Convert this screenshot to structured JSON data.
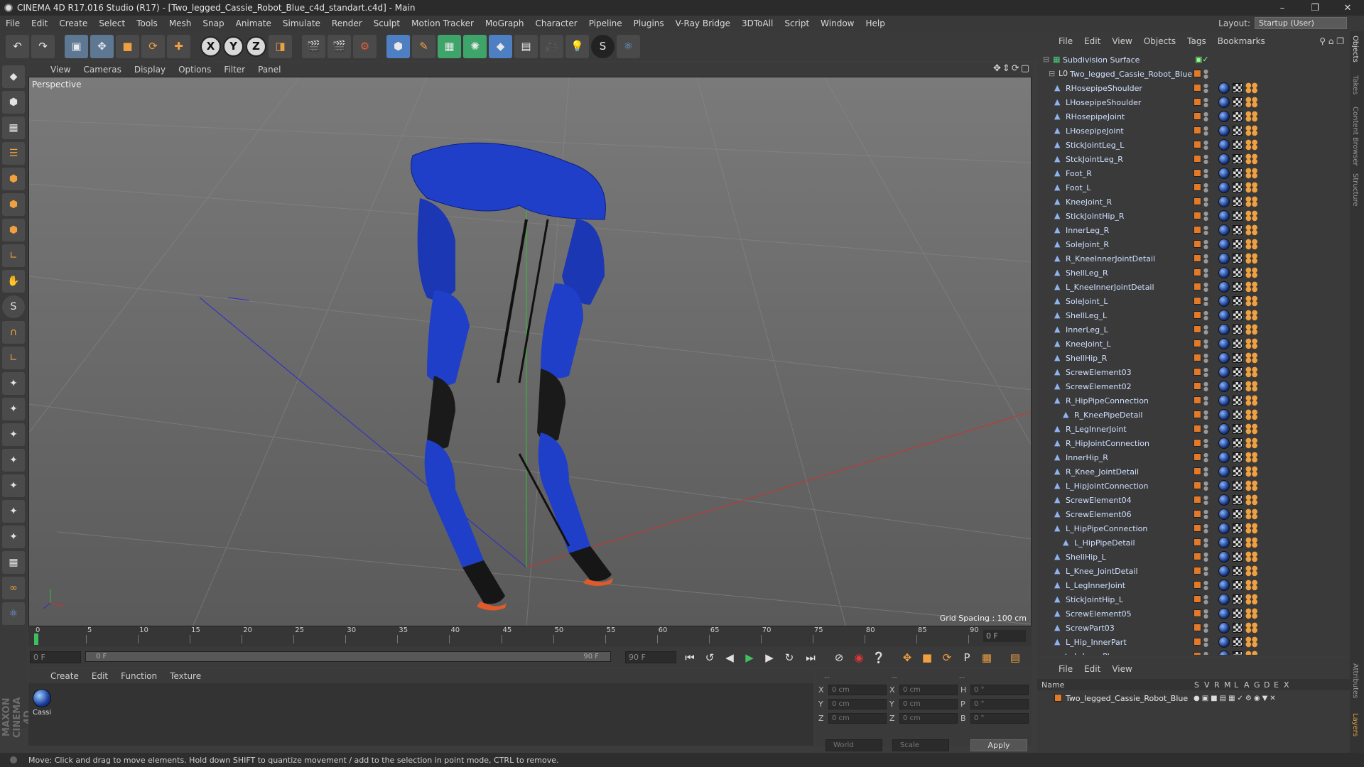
{
  "titlebar": {
    "title": "CINEMA 4D R17.016 Studio (R17) - [Two_legged_Cassie_Robot_Blue_c4d_standart.c4d] - Main"
  },
  "menubar": [
    "File",
    "Edit",
    "Create",
    "Select",
    "Tools",
    "Mesh",
    "Snap",
    "Animate",
    "Simulate",
    "Render",
    "Sculpt",
    "Motion Tracker",
    "MoGraph",
    "Character",
    "Pipeline",
    "Plugins",
    "V-Ray Bridge",
    "3DToAll",
    "Script",
    "Window",
    "Help"
  ],
  "layout": {
    "label": "Layout:",
    "value": "Startup (User)"
  },
  "viewport": {
    "menu": [
      "View",
      "Cameras",
      "Display",
      "Options",
      "Filter",
      "Panel"
    ],
    "label": "Perspective",
    "grid_spacing": "Grid Spacing : 100 cm"
  },
  "timeline": {
    "ticks": [
      "0",
      "5",
      "10",
      "15",
      "20",
      "25",
      "30",
      "35",
      "40",
      "45",
      "50",
      "55",
      "60",
      "65",
      "70",
      "75",
      "80",
      "85",
      "90"
    ],
    "current_frame": "0 F"
  },
  "transport": {
    "start": "0 F",
    "slider_start": "0 F",
    "slider_end": "90 F",
    "end": "90 F"
  },
  "material_manager": {
    "menu": [
      "Create",
      "Edit",
      "Function",
      "Texture"
    ],
    "materials": [
      {
        "name": "Cassi"
      }
    ]
  },
  "attributes": {
    "headers": [
      "--",
      "--",
      "--"
    ],
    "rows": [
      {
        "a": "X",
        "av": "0 cm",
        "b": "X",
        "bv": "0 cm",
        "c": "H",
        "cv": "0 °"
      },
      {
        "a": "Y",
        "av": "0 cm",
        "b": "Y",
        "bv": "0 cm",
        "c": "P",
        "cv": "0 °"
      },
      {
        "a": "Z",
        "av": "0 cm",
        "b": "Z",
        "bv": "0 cm",
        "c": "B",
        "cv": "0 °"
      }
    ],
    "coord_mode": "World",
    "scale_mode": "Scale",
    "apply_label": "Apply"
  },
  "status": {
    "text": "Move: Click and drag to move elements. Hold down SHIFT to quantize movement / add to the selection in point mode, CTRL to remove."
  },
  "object_manager": {
    "menu": [
      "File",
      "Edit",
      "View",
      "Objects",
      "Tags",
      "Bookmarks"
    ],
    "root": "Subdivision Surface",
    "group": "Two_legged_Cassie_Robot_Blue",
    "objects": [
      {
        "name": "RHosepipeShoulder",
        "indent": 0
      },
      {
        "name": "LHosepipeShoulder",
        "indent": 0
      },
      {
        "name": "RHosepipeJoint",
        "indent": 0
      },
      {
        "name": "LHosepipeJoint",
        "indent": 0
      },
      {
        "name": "StickJointLeg_L",
        "indent": 0
      },
      {
        "name": "StckJointLeg_R",
        "indent": 0
      },
      {
        "name": "Foot_R",
        "indent": 0
      },
      {
        "name": "Foot_L",
        "indent": 0
      },
      {
        "name": "KneeJoint_R",
        "indent": 0
      },
      {
        "name": "StickJointHip_R",
        "indent": 0
      },
      {
        "name": "InnerLeg_R",
        "indent": 0
      },
      {
        "name": "SoleJoint_R",
        "indent": 0
      },
      {
        "name": "R_KneeInnerJointDetail",
        "indent": 0
      },
      {
        "name": "ShellLeg_R",
        "indent": 0
      },
      {
        "name": "L_KneeInnerJointDetail",
        "indent": 0
      },
      {
        "name": "SoleJoint_L",
        "indent": 0
      },
      {
        "name": "ShellLeg_L",
        "indent": 0
      },
      {
        "name": "InnerLeg_L",
        "indent": 0
      },
      {
        "name": "KneeJoint_L",
        "indent": 0
      },
      {
        "name": "ShellHip_R",
        "indent": 0
      },
      {
        "name": "ScrewElement03",
        "indent": 0
      },
      {
        "name": "ScrewElement02",
        "indent": 0
      },
      {
        "name": "R_HipPipeConnection",
        "indent": 0
      },
      {
        "name": "R_KneePipeDetail",
        "indent": 1
      },
      {
        "name": "R_LegInnerJoint",
        "indent": 0
      },
      {
        "name": "R_HipJointConnection",
        "indent": 0
      },
      {
        "name": "InnerHip_R",
        "indent": 0
      },
      {
        "name": "R_Knee_JointDetail",
        "indent": 0
      },
      {
        "name": "L_HipJointConnection",
        "indent": 0
      },
      {
        "name": "ScrewElement04",
        "indent": 0
      },
      {
        "name": "ScrewElement06",
        "indent": 0
      },
      {
        "name": "L_HipPipeConnection",
        "indent": 0
      },
      {
        "name": "L_HipPipeDetail",
        "indent": 1
      },
      {
        "name": "ShellHip_L",
        "indent": 0
      },
      {
        "name": "L_Knee_JointDetail",
        "indent": 0
      },
      {
        "name": "L_LegInnerJoint",
        "indent": 0
      },
      {
        "name": "StickJointHip_L",
        "indent": 0
      },
      {
        "name": "ScrewElement05",
        "indent": 0
      },
      {
        "name": "ScrewPart03",
        "indent": 0
      },
      {
        "name": "L_Hip_InnerPart",
        "indent": 0
      },
      {
        "name": "L_InnerPlug",
        "indent": 1
      }
    ]
  },
  "layer_manager": {
    "menu": [
      "File",
      "Edit",
      "View"
    ],
    "columns": [
      "Name",
      "S",
      "V",
      "R",
      "M",
      "L",
      "A",
      "G",
      "D",
      "E",
      "X"
    ],
    "layers": [
      {
        "name": "Two_legged_Cassie_Robot_Blue"
      }
    ]
  },
  "side_tabs": [
    "Objects",
    "Takes",
    "Content Browser",
    "Structure",
    "Attributes",
    "Layers"
  ],
  "colors": {
    "robot_blue": "#1f3fc9",
    "accent": "#e27a2a",
    "play": "#41c05c",
    "record": "#e23636"
  }
}
